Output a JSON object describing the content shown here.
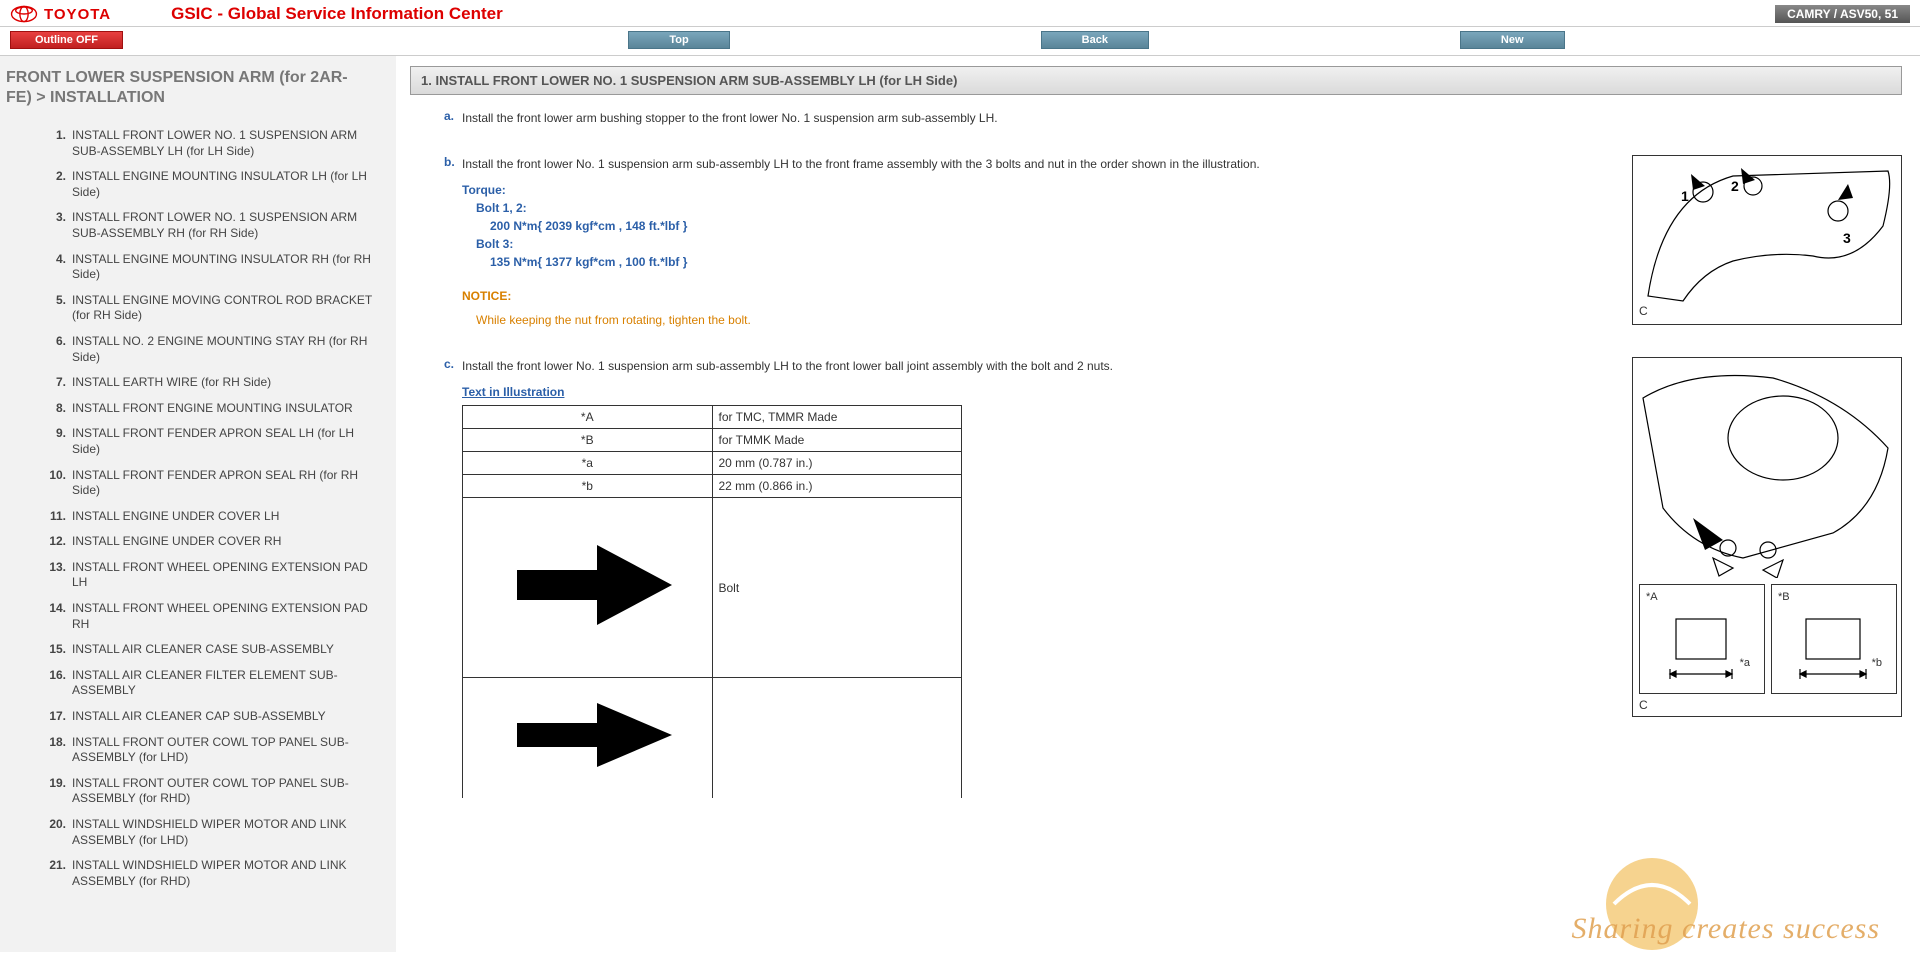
{
  "header": {
    "brand": "TOYOTA",
    "title": "GSIC - Global Service Information Center",
    "vehicle": "CAMRY / ASV50, 51"
  },
  "subnav": {
    "outline": "Outline OFF",
    "top": "Top",
    "back": "Back",
    "new": "New"
  },
  "breadcrumb": "FRONT LOWER SUSPENSION ARM (for 2AR-FE) > INSTALLATION",
  "toc": [
    {
      "n": "1.",
      "t": "INSTALL FRONT LOWER NO. 1 SUSPENSION ARM SUB-ASSEMBLY LH (for LH Side)"
    },
    {
      "n": "2.",
      "t": "INSTALL ENGINE MOUNTING INSULATOR LH (for LH Side)"
    },
    {
      "n": "3.",
      "t": "INSTALL FRONT LOWER NO. 1 SUSPENSION ARM SUB-ASSEMBLY RH (for RH Side)"
    },
    {
      "n": "4.",
      "t": "INSTALL ENGINE MOUNTING INSULATOR RH (for RH Side)"
    },
    {
      "n": "5.",
      "t": "INSTALL ENGINE MOVING CONTROL ROD BRACKET (for RH Side)"
    },
    {
      "n": "6.",
      "t": "INSTALL NO. 2 ENGINE MOUNTING STAY RH (for RH Side)"
    },
    {
      "n": "7.",
      "t": "INSTALL EARTH WIRE (for RH Side)"
    },
    {
      "n": "8.",
      "t": "INSTALL FRONT ENGINE MOUNTING INSULATOR"
    },
    {
      "n": "9.",
      "t": "INSTALL FRONT FENDER APRON SEAL LH (for LH Side)"
    },
    {
      "n": "10.",
      "t": "INSTALL FRONT FENDER APRON SEAL RH (for RH Side)"
    },
    {
      "n": "11.",
      "t": "INSTALL ENGINE UNDER COVER LH"
    },
    {
      "n": "12.",
      "t": "INSTALL ENGINE UNDER COVER RH"
    },
    {
      "n": "13.",
      "t": "INSTALL FRONT WHEEL OPENING EXTENSION PAD LH"
    },
    {
      "n": "14.",
      "t": "INSTALL FRONT WHEEL OPENING EXTENSION PAD RH"
    },
    {
      "n": "15.",
      "t": "INSTALL AIR CLEANER CASE SUB-ASSEMBLY"
    },
    {
      "n": "16.",
      "t": "INSTALL AIR CLEANER FILTER ELEMENT SUB-ASSEMBLY"
    },
    {
      "n": "17.",
      "t": "INSTALL AIR CLEANER CAP SUB-ASSEMBLY"
    },
    {
      "n": "18.",
      "t": "INSTALL FRONT OUTER COWL TOP PANEL SUB-ASSEMBLY (for LHD)"
    },
    {
      "n": "19.",
      "t": "INSTALL FRONT OUTER COWL TOP PANEL SUB-ASSEMBLY (for RHD)"
    },
    {
      "n": "20.",
      "t": "INSTALL WINDSHIELD WIPER MOTOR AND LINK ASSEMBLY (for LHD)"
    },
    {
      "n": "21.",
      "t": "INSTALL WINDSHIELD WIPER MOTOR AND LINK ASSEMBLY (for RHD)"
    }
  ],
  "section": {
    "title": "1. INSTALL FRONT LOWER NO. 1 SUSPENSION ARM SUB-ASSEMBLY LH (for LH Side)"
  },
  "steps": {
    "a": {
      "letter": "a.",
      "text": "Install the front lower arm bushing stopper to the front lower No. 1 suspension arm sub-assembly LH."
    },
    "b": {
      "letter": "b.",
      "text": "Install the front lower No. 1 suspension arm sub-assembly LH to the front frame assembly with the 3 bolts and nut in the order shown in the illustration.",
      "torque_label": "Torque:",
      "bolt12_label": "Bolt 1, 2:",
      "bolt12_val": "200 N*m{ 2039 kgf*cm , 148 ft.*lbf }",
      "bolt3_label": "Bolt 3:",
      "bolt3_val": "135 N*m{ 1377 kgf*cm , 100 ft.*lbf }",
      "notice_label": "NOTICE:",
      "notice_text": "While keeping the nut from rotating, tighten the bolt.",
      "illus_label": "C",
      "callout1": "1",
      "callout2": "2",
      "callout3": "3"
    },
    "c": {
      "letter": "c.",
      "text": "Install the front lower No. 1 suspension arm sub-assembly LH to the front lower ball joint assembly with the bolt and 2 nuts.",
      "text_illus_label": "Text in Illustration",
      "table": {
        "r1k": "*A",
        "r1v": "for TMC, TMMR Made",
        "r2k": "*B",
        "r2v": "for TMMK Made",
        "r3k": "*a",
        "r3v": "20 mm (0.787 in.)",
        "r4k": "*b",
        "r4v": "22 mm (0.866 in.)",
        "r5v": "Bolt"
      },
      "illus_label": "C",
      "sub_a": "*A",
      "sub_b": "*B",
      "sub_a_dim": "*a",
      "sub_b_dim": "*b"
    }
  },
  "watermark": "Sharing creates success"
}
